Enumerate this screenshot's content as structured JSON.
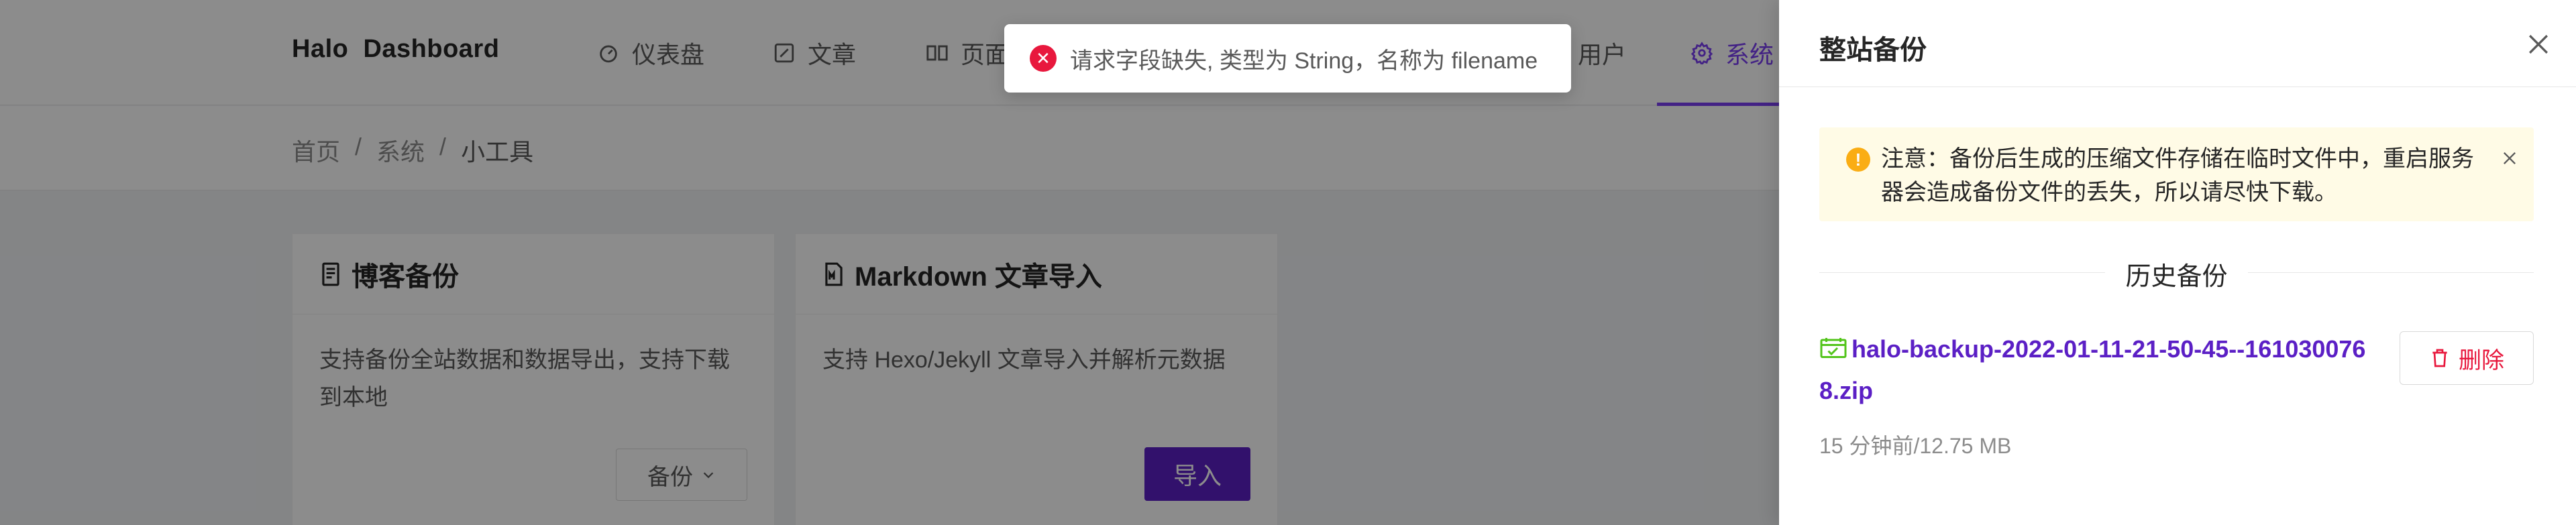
{
  "header": {
    "brand": "Halo  Dashboard",
    "nav": [
      {
        "label": "仪表盘",
        "icon": "dashboard-icon"
      },
      {
        "label": "文章",
        "icon": "edit-icon"
      },
      {
        "label": "页面",
        "icon": "read-icon"
      },
      {
        "label": "用户",
        "icon": "user-icon"
      },
      {
        "label": "系统",
        "icon": "setting-icon",
        "active": true
      }
    ]
  },
  "breadcrumb": {
    "items": [
      "首页",
      "/",
      "系统",
      "/",
      "小工具"
    ]
  },
  "cards": [
    {
      "title": "博客备份",
      "icon": "file-text-icon",
      "description": "支持备份全站数据和数据导出，支持下载到本地",
      "button_label": "备份"
    },
    {
      "title": "Markdown 文章导入",
      "icon": "file-markdown-icon",
      "description": "支持 Hexo/Jekyll 文章导入并解析元数据",
      "button_label": "导入"
    }
  ],
  "toast": {
    "message": "请求字段缺失, 类型为 String，名称为 filename",
    "icon": "error-icon"
  },
  "drawer": {
    "title": "整站备份",
    "alert": "注意：备份后生成的压缩文件存储在临时文件中，重启服务器会造成备份文件的丢失，所以请尽快下载。",
    "section_title": "历史备份",
    "backups": [
      {
        "filename": "halo-backup-2022-01-11-21-50-45--1610300768.zip",
        "meta": "15 分钟前/12.75 MB",
        "delete_label": "删除"
      }
    ]
  },
  "colors": {
    "accent": "#7b3ff2",
    "primary_button": "#5b1fc5",
    "error": "#e8183d",
    "warning": "#faad14",
    "alert_bg": "#fffbe6"
  }
}
